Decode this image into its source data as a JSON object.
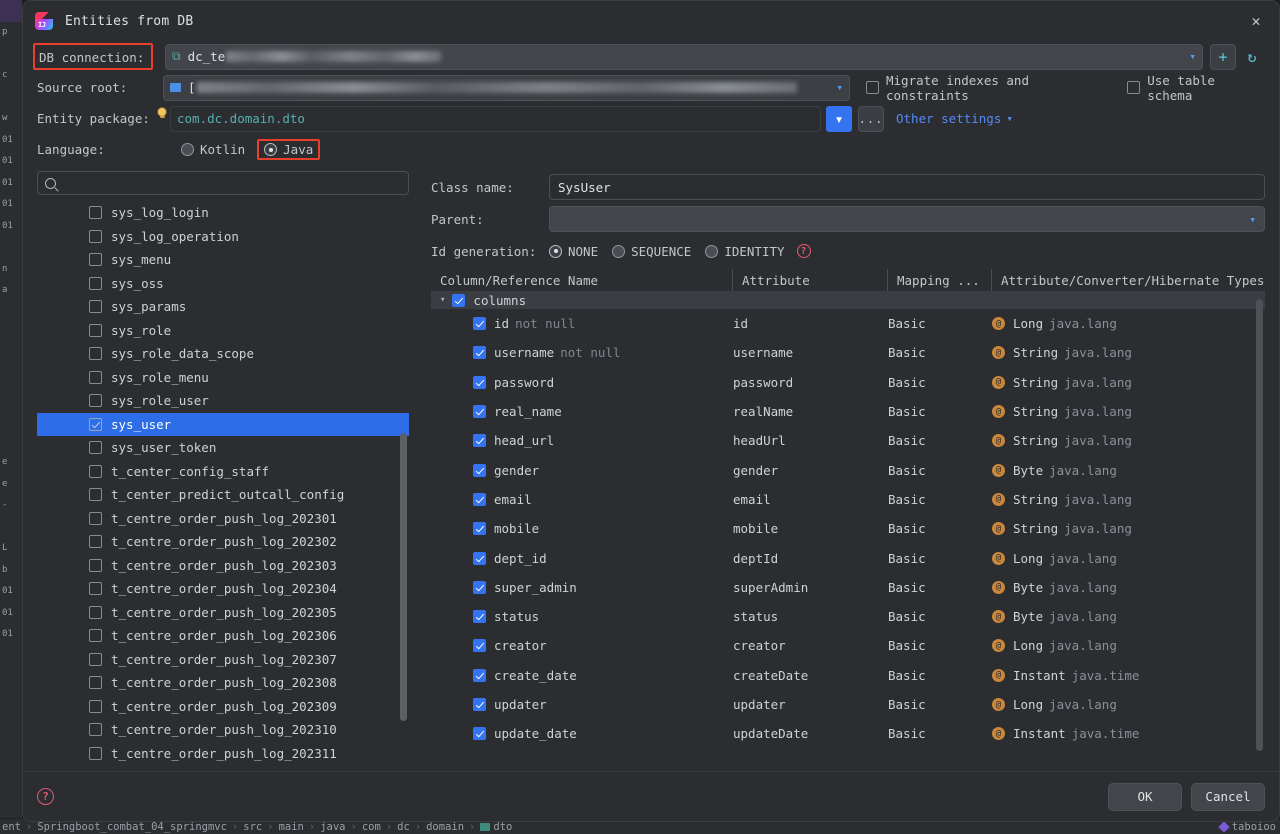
{
  "background": {
    "left_strip_lines": [
      "p",
      "",
      "c",
      "",
      "w",
      "01",
      "01",
      "01",
      "01",
      "01",
      "",
      "n",
      "a",
      "",
      "",
      "",
      "",
      "",
      "",
      "",
      "e",
      "e",
      "-",
      "",
      "L",
      "b",
      "01",
      "01",
      "01"
    ],
    "breadcrumb": [
      "ent",
      "Springboot_combat_04_springmvc",
      "src",
      "main",
      "java",
      "com",
      "dc",
      "domain",
      "dto"
    ],
    "breadcrumb_separator": "›",
    "status_right": "taboioo"
  },
  "dialog": {
    "title": "Entities from DB",
    "logo_icon": "intellij-idea-logo-icon",
    "close_icon": "close-icon"
  },
  "form": {
    "db_connection": {
      "label": "DB connection:",
      "value": "dc_te",
      "value_redacted": true,
      "leading_icon": "mysql-dolphin-icon",
      "dropdown_icon": "chevron-down-icon",
      "add_button_icon": "plus-icon",
      "refresh_button_icon": "refresh-icon",
      "highlighted": true
    },
    "source_root": {
      "label": "Source root:",
      "value": "[",
      "value_redacted": true,
      "leading_icon": "folder-icon",
      "dropdown_icon": "chevron-down-icon"
    },
    "entity_package": {
      "label": "Entity package:",
      "value": "com.dc.domain.dto",
      "hint_icon": "lightbulb-icon",
      "dropdown_icon": "chevron-down-icon",
      "browse_label": "...",
      "other_settings_label": "Other settings",
      "other_settings_icon": "chevron-down-icon"
    },
    "language": {
      "label": "Language:",
      "options": [
        {
          "label": "Kotlin",
          "selected": false
        },
        {
          "label": "Java",
          "selected": true,
          "highlighted": true
        }
      ]
    },
    "checkboxes": [
      {
        "label": "Migrate indexes and constraints",
        "checked": false
      },
      {
        "label": "Use table schema",
        "checked": false
      }
    ]
  },
  "tables_panel": {
    "search_placeholder": "",
    "search_icon": "search-icon",
    "items": [
      {
        "name": "sys_log_login",
        "checked": false,
        "selected": false
      },
      {
        "name": "sys_log_operation",
        "checked": false,
        "selected": false
      },
      {
        "name": "sys_menu",
        "checked": false,
        "selected": false
      },
      {
        "name": "sys_oss",
        "checked": false,
        "selected": false
      },
      {
        "name": "sys_params",
        "checked": false,
        "selected": false
      },
      {
        "name": "sys_role",
        "checked": false,
        "selected": false
      },
      {
        "name": "sys_role_data_scope",
        "checked": false,
        "selected": false
      },
      {
        "name": "sys_role_menu",
        "checked": false,
        "selected": false
      },
      {
        "name": "sys_role_user",
        "checked": false,
        "selected": false
      },
      {
        "name": "sys_user",
        "checked": true,
        "selected": true
      },
      {
        "name": "sys_user_token",
        "checked": false,
        "selected": false
      },
      {
        "name": "t_center_config_staff",
        "checked": false,
        "selected": false
      },
      {
        "name": "t_center_predict_outcall_config",
        "checked": false,
        "selected": false
      },
      {
        "name": "t_centre_order_push_log_202301",
        "checked": false,
        "selected": false
      },
      {
        "name": "t_centre_order_push_log_202302",
        "checked": false,
        "selected": false
      },
      {
        "name": "t_centre_order_push_log_202303",
        "checked": false,
        "selected": false
      },
      {
        "name": "t_centre_order_push_log_202304",
        "checked": false,
        "selected": false
      },
      {
        "name": "t_centre_order_push_log_202305",
        "checked": false,
        "selected": false
      },
      {
        "name": "t_centre_order_push_log_202306",
        "checked": false,
        "selected": false
      },
      {
        "name": "t_centre_order_push_log_202307",
        "checked": false,
        "selected": false
      },
      {
        "name": "t_centre_order_push_log_202308",
        "checked": false,
        "selected": false
      },
      {
        "name": "t_centre_order_push_log_202309",
        "checked": false,
        "selected": false
      },
      {
        "name": "t_centre_order_push_log_202310",
        "checked": false,
        "selected": false
      },
      {
        "name": "t_centre_order_push_log_202311",
        "checked": false,
        "selected": false
      }
    ]
  },
  "entity_panel": {
    "class_name": {
      "label": "Class name:",
      "value": "SysUser"
    },
    "parent": {
      "label": "Parent:",
      "value": "",
      "dropdown_icon": "chevron-down-icon"
    },
    "id_generation": {
      "label": "Id generation:",
      "options": [
        {
          "label": "NONE",
          "selected": true
        },
        {
          "label": "SEQUENCE",
          "selected": false
        },
        {
          "label": "IDENTITY",
          "selected": false
        }
      ],
      "help_icon": "help-circle-icon"
    },
    "table": {
      "headers": [
        "Column/Reference Name",
        "Attribute",
        "Mapping ...",
        "Attribute/Converter/Hibernate Types"
      ],
      "group_row": {
        "label": "columns",
        "checked": true,
        "expanded": true,
        "arrow_icon": "chevron-down-icon"
      },
      "rows": [
        {
          "column": "id",
          "modifier": "not null",
          "attribute": "id",
          "mapping": "Basic",
          "type": "Long",
          "package": "java.lang",
          "checked": true,
          "type_icon": "annotation-icon"
        },
        {
          "column": "username",
          "modifier": "not null",
          "attribute": "username",
          "mapping": "Basic",
          "type": "String",
          "package": "java.lang",
          "checked": true,
          "type_icon": "annotation-icon"
        },
        {
          "column": "password",
          "modifier": "",
          "attribute": "password",
          "mapping": "Basic",
          "type": "String",
          "package": "java.lang",
          "checked": true,
          "type_icon": "annotation-icon"
        },
        {
          "column": "real_name",
          "modifier": "",
          "attribute": "realName",
          "mapping": "Basic",
          "type": "String",
          "package": "java.lang",
          "checked": true,
          "type_icon": "annotation-icon"
        },
        {
          "column": "head_url",
          "modifier": "",
          "attribute": "headUrl",
          "mapping": "Basic",
          "type": "String",
          "package": "java.lang",
          "checked": true,
          "type_icon": "annotation-icon"
        },
        {
          "column": "gender",
          "modifier": "",
          "attribute": "gender",
          "mapping": "Basic",
          "type": "Byte",
          "package": "java.lang",
          "checked": true,
          "type_icon": "annotation-icon"
        },
        {
          "column": "email",
          "modifier": "",
          "attribute": "email",
          "mapping": "Basic",
          "type": "String",
          "package": "java.lang",
          "checked": true,
          "type_icon": "annotation-icon"
        },
        {
          "column": "mobile",
          "modifier": "",
          "attribute": "mobile",
          "mapping": "Basic",
          "type": "String",
          "package": "java.lang",
          "checked": true,
          "type_icon": "annotation-icon"
        },
        {
          "column": "dept_id",
          "modifier": "",
          "attribute": "deptId",
          "mapping": "Basic",
          "type": "Long",
          "package": "java.lang",
          "checked": true,
          "type_icon": "annotation-icon"
        },
        {
          "column": "super_admin",
          "modifier": "",
          "attribute": "superAdmin",
          "mapping": "Basic",
          "type": "Byte",
          "package": "java.lang",
          "checked": true,
          "type_icon": "annotation-icon"
        },
        {
          "column": "status",
          "modifier": "",
          "attribute": "status",
          "mapping": "Basic",
          "type": "Byte",
          "package": "java.lang",
          "checked": true,
          "type_icon": "annotation-icon"
        },
        {
          "column": "creator",
          "modifier": "",
          "attribute": "creator",
          "mapping": "Basic",
          "type": "Long",
          "package": "java.lang",
          "checked": true,
          "type_icon": "annotation-icon"
        },
        {
          "column": "create_date",
          "modifier": "",
          "attribute": "createDate",
          "mapping": "Basic",
          "type": "Instant",
          "package": "java.time",
          "checked": true,
          "type_icon": "annotation-icon"
        },
        {
          "column": "updater",
          "modifier": "",
          "attribute": "updater",
          "mapping": "Basic",
          "type": "Long",
          "package": "java.lang",
          "checked": true,
          "type_icon": "annotation-icon"
        },
        {
          "column": "update_date",
          "modifier": "",
          "attribute": "updateDate",
          "mapping": "Basic",
          "type": "Instant",
          "package": "java.time",
          "checked": true,
          "type_icon": "annotation-icon"
        }
      ]
    }
  },
  "footer": {
    "help_icon": "help-circle-icon",
    "ok_label": "OK",
    "cancel_label": "Cancel"
  },
  "colors": {
    "accent_blue": "#3574f0",
    "selection_blue": "#2d6ee8",
    "link_blue": "#548af7",
    "highlight_red": "#e8402a",
    "package_green": "#55b0b0",
    "annotation_orange": "#c8873a"
  }
}
